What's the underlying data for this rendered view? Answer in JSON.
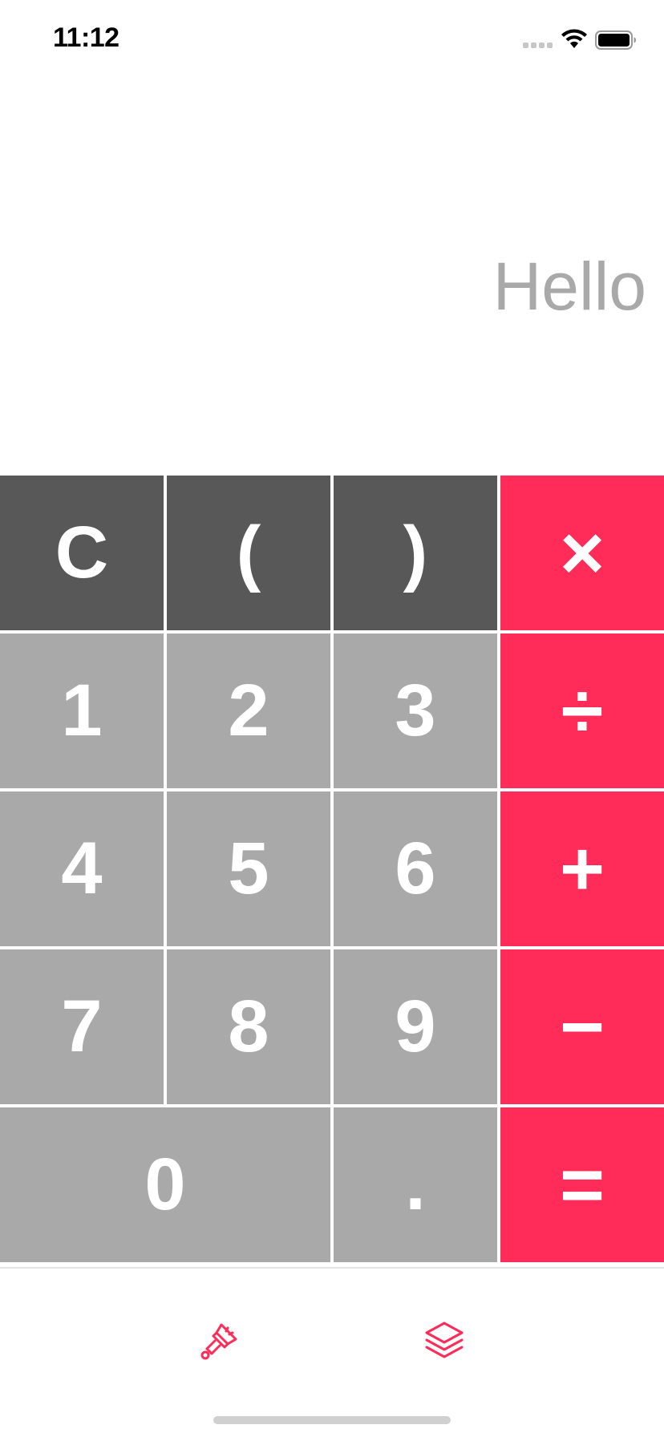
{
  "status_bar": {
    "time": "11:12"
  },
  "display": {
    "text": "Hello"
  },
  "keypad": {
    "rows": [
      [
        {
          "label": "C",
          "name": "clear-button",
          "style": "dark"
        },
        {
          "label": "(",
          "name": "open-paren-button",
          "style": "dark"
        },
        {
          "label": ")",
          "name": "close-paren-button",
          "style": "dark"
        },
        {
          "label": "×",
          "name": "multiply-button",
          "style": "accent"
        }
      ],
      [
        {
          "label": "1",
          "name": "digit-1-button",
          "style": "light"
        },
        {
          "label": "2",
          "name": "digit-2-button",
          "style": "light"
        },
        {
          "label": "3",
          "name": "digit-3-button",
          "style": "light"
        },
        {
          "label": "÷",
          "name": "divide-button",
          "style": "accent"
        }
      ],
      [
        {
          "label": "4",
          "name": "digit-4-button",
          "style": "light"
        },
        {
          "label": "5",
          "name": "digit-5-button",
          "style": "light"
        },
        {
          "label": "6",
          "name": "digit-6-button",
          "style": "light"
        },
        {
          "label": "+",
          "name": "add-button",
          "style": "accent"
        }
      ],
      [
        {
          "label": "7",
          "name": "digit-7-button",
          "style": "light"
        },
        {
          "label": "8",
          "name": "digit-8-button",
          "style": "light"
        },
        {
          "label": "9",
          "name": "digit-9-button",
          "style": "light"
        },
        {
          "label": "−",
          "name": "subtract-button",
          "style": "accent"
        }
      ],
      [
        {
          "label": "0",
          "name": "digit-0-button",
          "style": "light"
        },
        {
          "label": ".",
          "name": "decimal-button",
          "style": "light"
        },
        {
          "label": "=",
          "name": "equals-button",
          "style": "accent"
        }
      ]
    ]
  },
  "tab_bar": {
    "items": [
      {
        "icon": "paintbrush-icon"
      },
      {
        "icon": "layers-icon"
      }
    ]
  },
  "colors": {
    "accent": "#ff2b58",
    "dark_key": "#585858",
    "light_key": "#a9a9a9",
    "display_text": "#a9a9a9"
  }
}
